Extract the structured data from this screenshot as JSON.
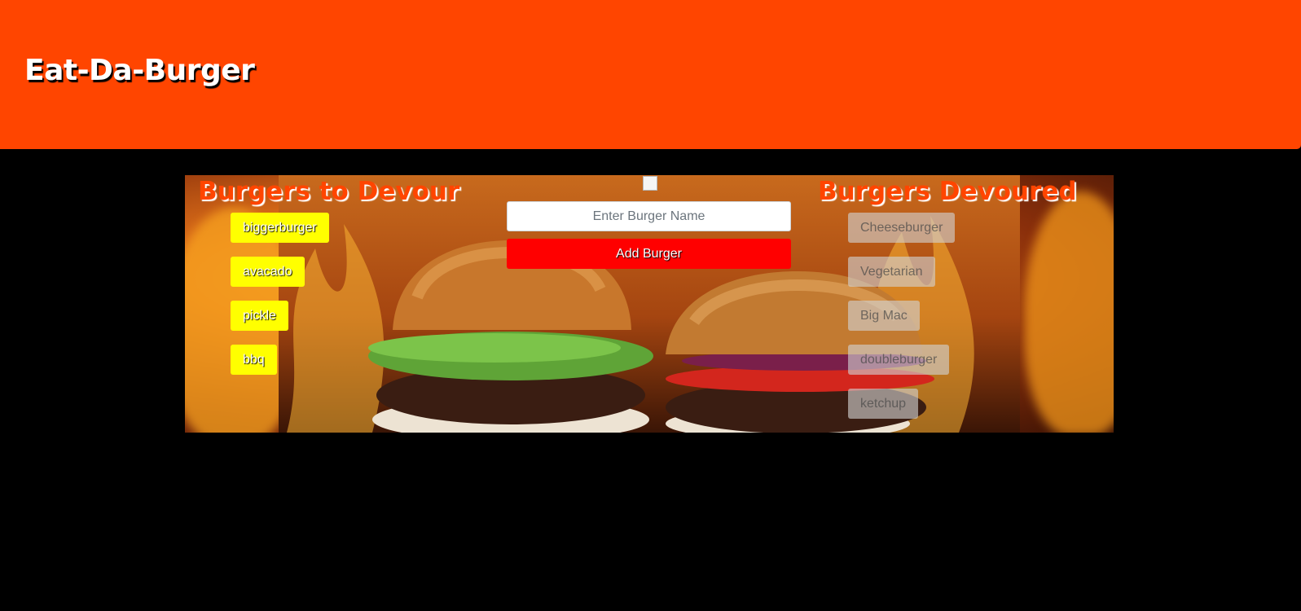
{
  "header": {
    "title": "Eat-Da-Burger"
  },
  "hero": {
    "broken_image_glyph": "img"
  },
  "to_devour": {
    "title": "Burgers to Devour",
    "items": [
      {
        "label": "biggerburger"
      },
      {
        "label": "avacado"
      },
      {
        "label": "pickle"
      },
      {
        "label": "bbq"
      }
    ]
  },
  "devoured": {
    "title": "Burgers Devoured",
    "items": [
      {
        "label": "Cheeseburger"
      },
      {
        "label": "Vegetarian"
      },
      {
        "label": "Big Mac"
      },
      {
        "label": "doubleburger"
      },
      {
        "label": "ketchup"
      }
    ]
  },
  "form": {
    "input_placeholder": "Enter Burger Name",
    "input_value": "",
    "submit_label": "Add Burger"
  },
  "colors": {
    "header_bg": "#ff4500",
    "page_bg": "#000000",
    "devour_button": "#ffff00",
    "add_button": "#ff0000",
    "section_title": "#ff4500"
  }
}
